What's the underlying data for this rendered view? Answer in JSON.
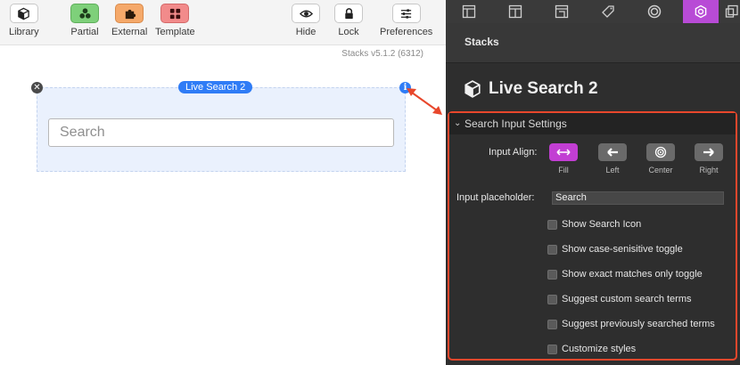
{
  "toolbar": {
    "library": "Library",
    "partial": "Partial",
    "external": "External",
    "template": "Template",
    "hide": "Hide",
    "lock": "Lock",
    "preferences": "Preferences"
  },
  "version": "Stacks v5.1.2 (6312)",
  "stack": {
    "title": "Live Search 2",
    "search_placeholder": "Search"
  },
  "inspector": {
    "header": "Stacks",
    "title": "Live Search 2",
    "section": "Search Input Settings",
    "input_align_label": "Input Align:",
    "align_options": [
      "Fill",
      "Left",
      "Center",
      "Right"
    ],
    "align_selected": "Fill",
    "placeholder_label": "Input placeholder:",
    "placeholder_value": "Search",
    "options": [
      {
        "label": "Show Search Icon",
        "checked": false
      },
      {
        "label": "Show case-senisitive toggle",
        "checked": false
      },
      {
        "label": "Show exact matches only toggle",
        "checked": false
      },
      {
        "label": "Suggest custom search terms",
        "checked": false
      },
      {
        "label": "Suggest previously searched terms",
        "checked": false
      },
      {
        "label": "Customize styles",
        "checked": false
      }
    ]
  },
  "colors": {
    "accent_blue": "#2f7cf6",
    "active_tab": "#b84bd6",
    "highlight_red": "#e8472c",
    "partial_green": "#7ed07a",
    "external_orange": "#f5a96a",
    "template_red": "#f28b8b"
  },
  "icons": {
    "library": "cube-icon",
    "partial": "blocks-icon",
    "external": "puzzle-icon",
    "template": "grid-icon",
    "hide": "eye-icon",
    "lock": "lock-icon",
    "preferences": "sliders-icon"
  }
}
